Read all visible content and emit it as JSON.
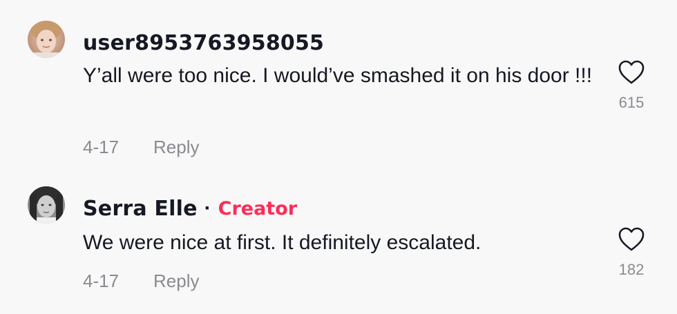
{
  "comments": [
    {
      "username": "user8953763958055",
      "creator_badge": "",
      "text": "Y’all were too nice. I would’ve smashed it on his door !!!",
      "date": "4-17",
      "reply_label": "Reply",
      "like_count": "615"
    },
    {
      "username": "Serra Elle",
      "separator": "·",
      "creator_badge": "Creator",
      "text": "We were nice at first. It definitely escalated.",
      "date": "4-17",
      "reply_label": "Reply",
      "like_count": "182"
    }
  ],
  "icons": {
    "like": "heart-outline-icon"
  },
  "colors": {
    "background": "#f8f8f8",
    "text_primary": "#161823",
    "text_secondary": "#8a8b91",
    "creator_accent": "#fe2c55"
  }
}
